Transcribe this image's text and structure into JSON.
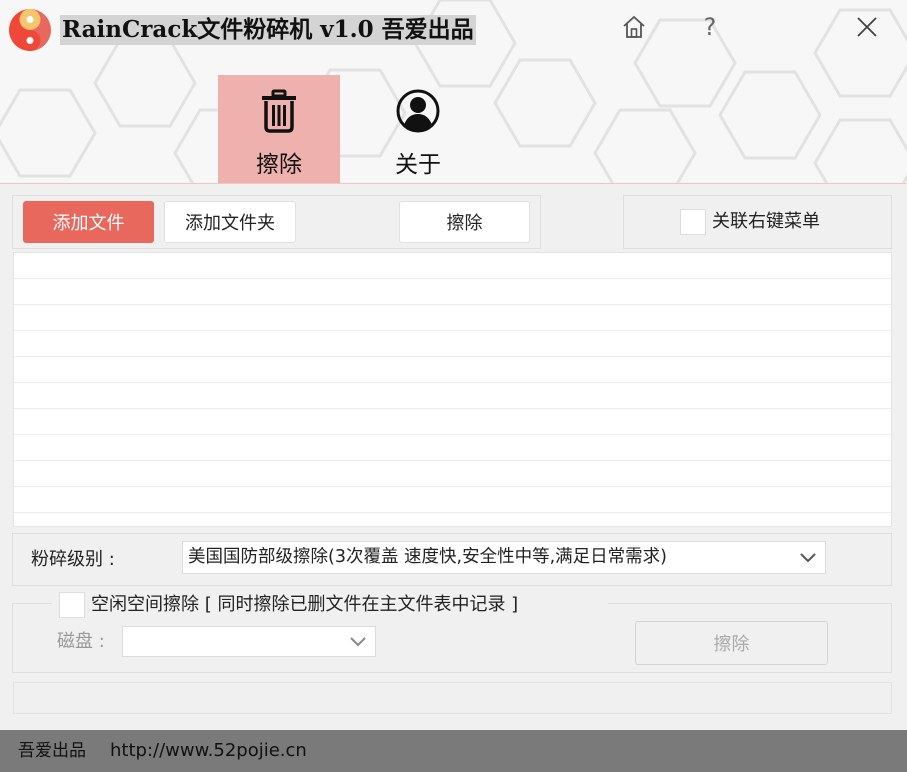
{
  "window": {
    "title": "RainCrack文件粉碎机 v1.0 吾爱出品",
    "home_icon": "home-icon",
    "help_label": "?",
    "close_icon": "close-icon"
  },
  "nav": {
    "tabs": [
      {
        "label": "擦除",
        "icon": "trash-icon",
        "active": true
      },
      {
        "label": "关于",
        "icon": "user-circle-icon",
        "active": false
      }
    ]
  },
  "toolbar": {
    "add_file_label": "添加文件",
    "add_folder_label": "添加文件夹",
    "erase_label": "擦除",
    "context_menu_label": "关联右键菜单",
    "context_menu_checked": false
  },
  "file_list": {
    "rows": [
      "",
      "",
      "",
      "",
      "",
      "",
      "",
      "",
      "",
      ""
    ]
  },
  "shred_level": {
    "label": "粉碎级别 :",
    "selected": "美国国防部级擦除(3次覆盖 速度快,安全性中等,满足日常需求)"
  },
  "free_space": {
    "label": "空闲空间擦除 [ 同时擦除已删文件在主文件表中记录 ]",
    "checked": false,
    "disk_label": "磁盘 :",
    "disk_selected": "",
    "erase_label": "擦除"
  },
  "footer": {
    "brand": "吾爱出品",
    "url": "http://www.52pojie.cn"
  },
  "colors": {
    "accent": "#e8685e",
    "active_tab": "#efb1ae",
    "footer": "#7a7a7a"
  }
}
